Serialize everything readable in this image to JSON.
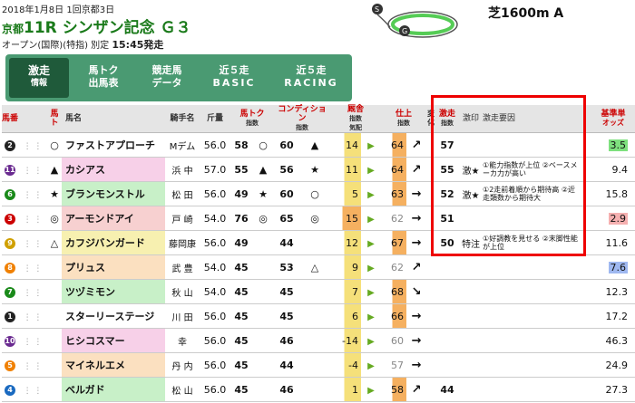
{
  "header": {
    "date": "2018年1月8日 1回京都3日",
    "venue": "京都",
    "race_no": "11R",
    "race_name": "シンザン記念 Ｇ３",
    "condition": "オープン(国際)(特指) 別定",
    "post_time": "15:45発走",
    "distance": "芝1600m A"
  },
  "tabs": [
    {
      "top": "激走",
      "bottom": "情報"
    },
    {
      "top": "馬トク",
      "bottom": "出馬表"
    },
    {
      "top": "競走馬",
      "bottom": "データ"
    },
    {
      "top": "近５走",
      "bottom": "BASIC"
    },
    {
      "top": "近５走",
      "bottom": "RACING"
    }
  ],
  "columns": {
    "uma": "馬番",
    "mark": "馬ト",
    "name": "馬名",
    "jockey": "騎手名",
    "weight": "斤量",
    "tok": "馬トク",
    "tok_sub": "指数",
    "cond": "コンディション",
    "cond_sub": "指数",
    "kyusha": "厩舎",
    "kyusha_sub": "指数",
    "kihai": "気配",
    "shiage": "仕上",
    "shiage_sub": "指数",
    "henka": "変化",
    "gekiso": "激走",
    "gekiso_sub": "指数",
    "gekiso_mark": "激印",
    "reason": "激走要因",
    "odds1": "基準単",
    "odds2": "オッズ"
  },
  "rows": [
    {
      "no": "2",
      "color": "#222",
      "mark": "○",
      "name": "ファストアプローチ",
      "bg": "#fff",
      "jockey": "Mデム",
      "weight": "56.0",
      "tok": "58",
      "tok_mark": "○",
      "cond": "60",
      "cond_mark": "▲",
      "kyu": "14",
      "kyu_c": "y",
      "shi": "64",
      "shi_c": "o",
      "hen": "↗",
      "gek": "57",
      "gmark": "",
      "reason": "",
      "odds": "3.5",
      "odds_hl": "g"
    },
    {
      "no": "11",
      "color": "#6a2a90",
      "mark": "▲",
      "name": "カシアス",
      "bg": "#f7d0e8",
      "jockey": "浜 中",
      "weight": "57.0",
      "tok": "55",
      "tok_mark": "▲",
      "cond": "56",
      "cond_mark": "★",
      "kyu": "11",
      "kyu_c": "y",
      "shi": "64",
      "shi_c": "o",
      "hen": "↗",
      "gek": "55",
      "gmark": "激★",
      "reason": "①能力指数が上位 ②ベースメーカ力が高い",
      "odds": "9.4",
      "odds_hl": ""
    },
    {
      "no": "6",
      "color": "#1a8a1a",
      "mark": "★",
      "name": "ブランモンストル",
      "bg": "#c8f0c8",
      "jockey": "松 田",
      "weight": "56.0",
      "tok": "49",
      "tok_mark": "★",
      "cond": "60",
      "cond_mark": "○",
      "kyu": "5",
      "kyu_c": "y",
      "shi": "63",
      "shi_c": "o",
      "hen": "→",
      "gek": "52",
      "gmark": "激★",
      "reason": "①2走前着順から期待高 ②近走類数から期待大",
      "odds": "15.8",
      "odds_hl": ""
    },
    {
      "no": "3",
      "color": "#c00",
      "mark": "◎",
      "name": "アーモンドアイ",
      "bg": "#f7d0d0",
      "jockey": "戸 崎",
      "weight": "54.0",
      "tok": "76",
      "tok_mark": "◎",
      "cond": "65",
      "cond_mark": "◎",
      "kyu": "15",
      "kyu_c": "o",
      "shi": "62",
      "shi_c": "",
      "hen": "→",
      "gek": "51",
      "gmark": "",
      "reason": "",
      "odds": "2.9",
      "odds_hl": "r"
    },
    {
      "no": "9",
      "color": "#d0a000",
      "mark": "△",
      "name": "カフジバンガード",
      "bg": "#f7f0b0",
      "jockey": "藤岡康",
      "weight": "56.0",
      "tok": "49",
      "tok_mark": "",
      "cond": "44",
      "cond_mark": "",
      "kyu": "12",
      "kyu_c": "y",
      "shi": "67",
      "shi_c": "o",
      "hen": "→",
      "gek": "50",
      "gmark": "特注",
      "reason": "①好調教を見せる ②末脚性能が上位",
      "odds": "11.6",
      "odds_hl": ""
    },
    {
      "no": "8",
      "color": "#f08000",
      "mark": "",
      "name": "プリュス",
      "bg": "#fbe0c0",
      "jockey": "武 豊",
      "weight": "54.0",
      "tok": "45",
      "tok_mark": "",
      "cond": "53",
      "cond_mark": "△",
      "kyu": "9",
      "kyu_c": "y",
      "shi": "62",
      "shi_c": "",
      "hen": "↗",
      "gek": "",
      "gmark": "",
      "reason": "",
      "odds": "7.6",
      "odds_hl": "b"
    },
    {
      "no": "7",
      "color": "#1a8a1a",
      "mark": "",
      "name": "ツヅミモン",
      "bg": "#c8f0c8",
      "jockey": "秋 山",
      "weight": "54.0",
      "tok": "45",
      "tok_mark": "",
      "cond": "45",
      "cond_mark": "",
      "kyu": "7",
      "kyu_c": "y",
      "shi": "68",
      "shi_c": "o",
      "hen": "↘",
      "gek": "",
      "gmark": "",
      "reason": "",
      "odds": "12.3",
      "odds_hl": ""
    },
    {
      "no": "1",
      "color": "#222",
      "mark": "",
      "name": "スターリーステージ",
      "bg": "#fff",
      "jockey": "川 田",
      "weight": "56.0",
      "tok": "45",
      "tok_mark": "",
      "cond": "45",
      "cond_mark": "",
      "kyu": "6",
      "kyu_c": "y",
      "shi": "66",
      "shi_c": "o",
      "hen": "→",
      "gek": "",
      "gmark": "",
      "reason": "",
      "odds": "17.2",
      "odds_hl": ""
    },
    {
      "no": "10",
      "color": "#6a2a90",
      "mark": "",
      "name": "ヒシコスマー",
      "bg": "#f7d0e8",
      "jockey": "幸",
      "weight": "56.0",
      "tok": "45",
      "tok_mark": "",
      "cond": "46",
      "cond_mark": "",
      "kyu": "-14",
      "kyu_c": "y",
      "shi": "60",
      "shi_c": "",
      "hen": "→",
      "gek": "",
      "gmark": "",
      "reason": "",
      "odds": "46.3",
      "odds_hl": ""
    },
    {
      "no": "5",
      "color": "#f08000",
      "mark": "",
      "name": "マイネルエメ",
      "bg": "#fbe0c0",
      "jockey": "丹 内",
      "weight": "56.0",
      "tok": "45",
      "tok_mark": "",
      "cond": "44",
      "cond_mark": "",
      "kyu": "-4",
      "kyu_c": "y",
      "shi": "57",
      "shi_c": "",
      "hen": "→",
      "gek": "",
      "gmark": "",
      "reason": "",
      "odds": "24.9",
      "odds_hl": ""
    },
    {
      "no": "4",
      "color": "#1a6ac0",
      "mark": "",
      "name": "ベルガド",
      "bg": "#c8f0c8",
      "jockey": "松 山",
      "weight": "56.0",
      "tok": "45",
      "tok_mark": "",
      "cond": "46",
      "cond_mark": "",
      "kyu": "1",
      "kyu_c": "y",
      "shi": "58",
      "shi_c": "o",
      "hen": "↗",
      "gek": "44",
      "gmark": "",
      "reason": "",
      "odds": "27.3",
      "odds_hl": ""
    }
  ]
}
